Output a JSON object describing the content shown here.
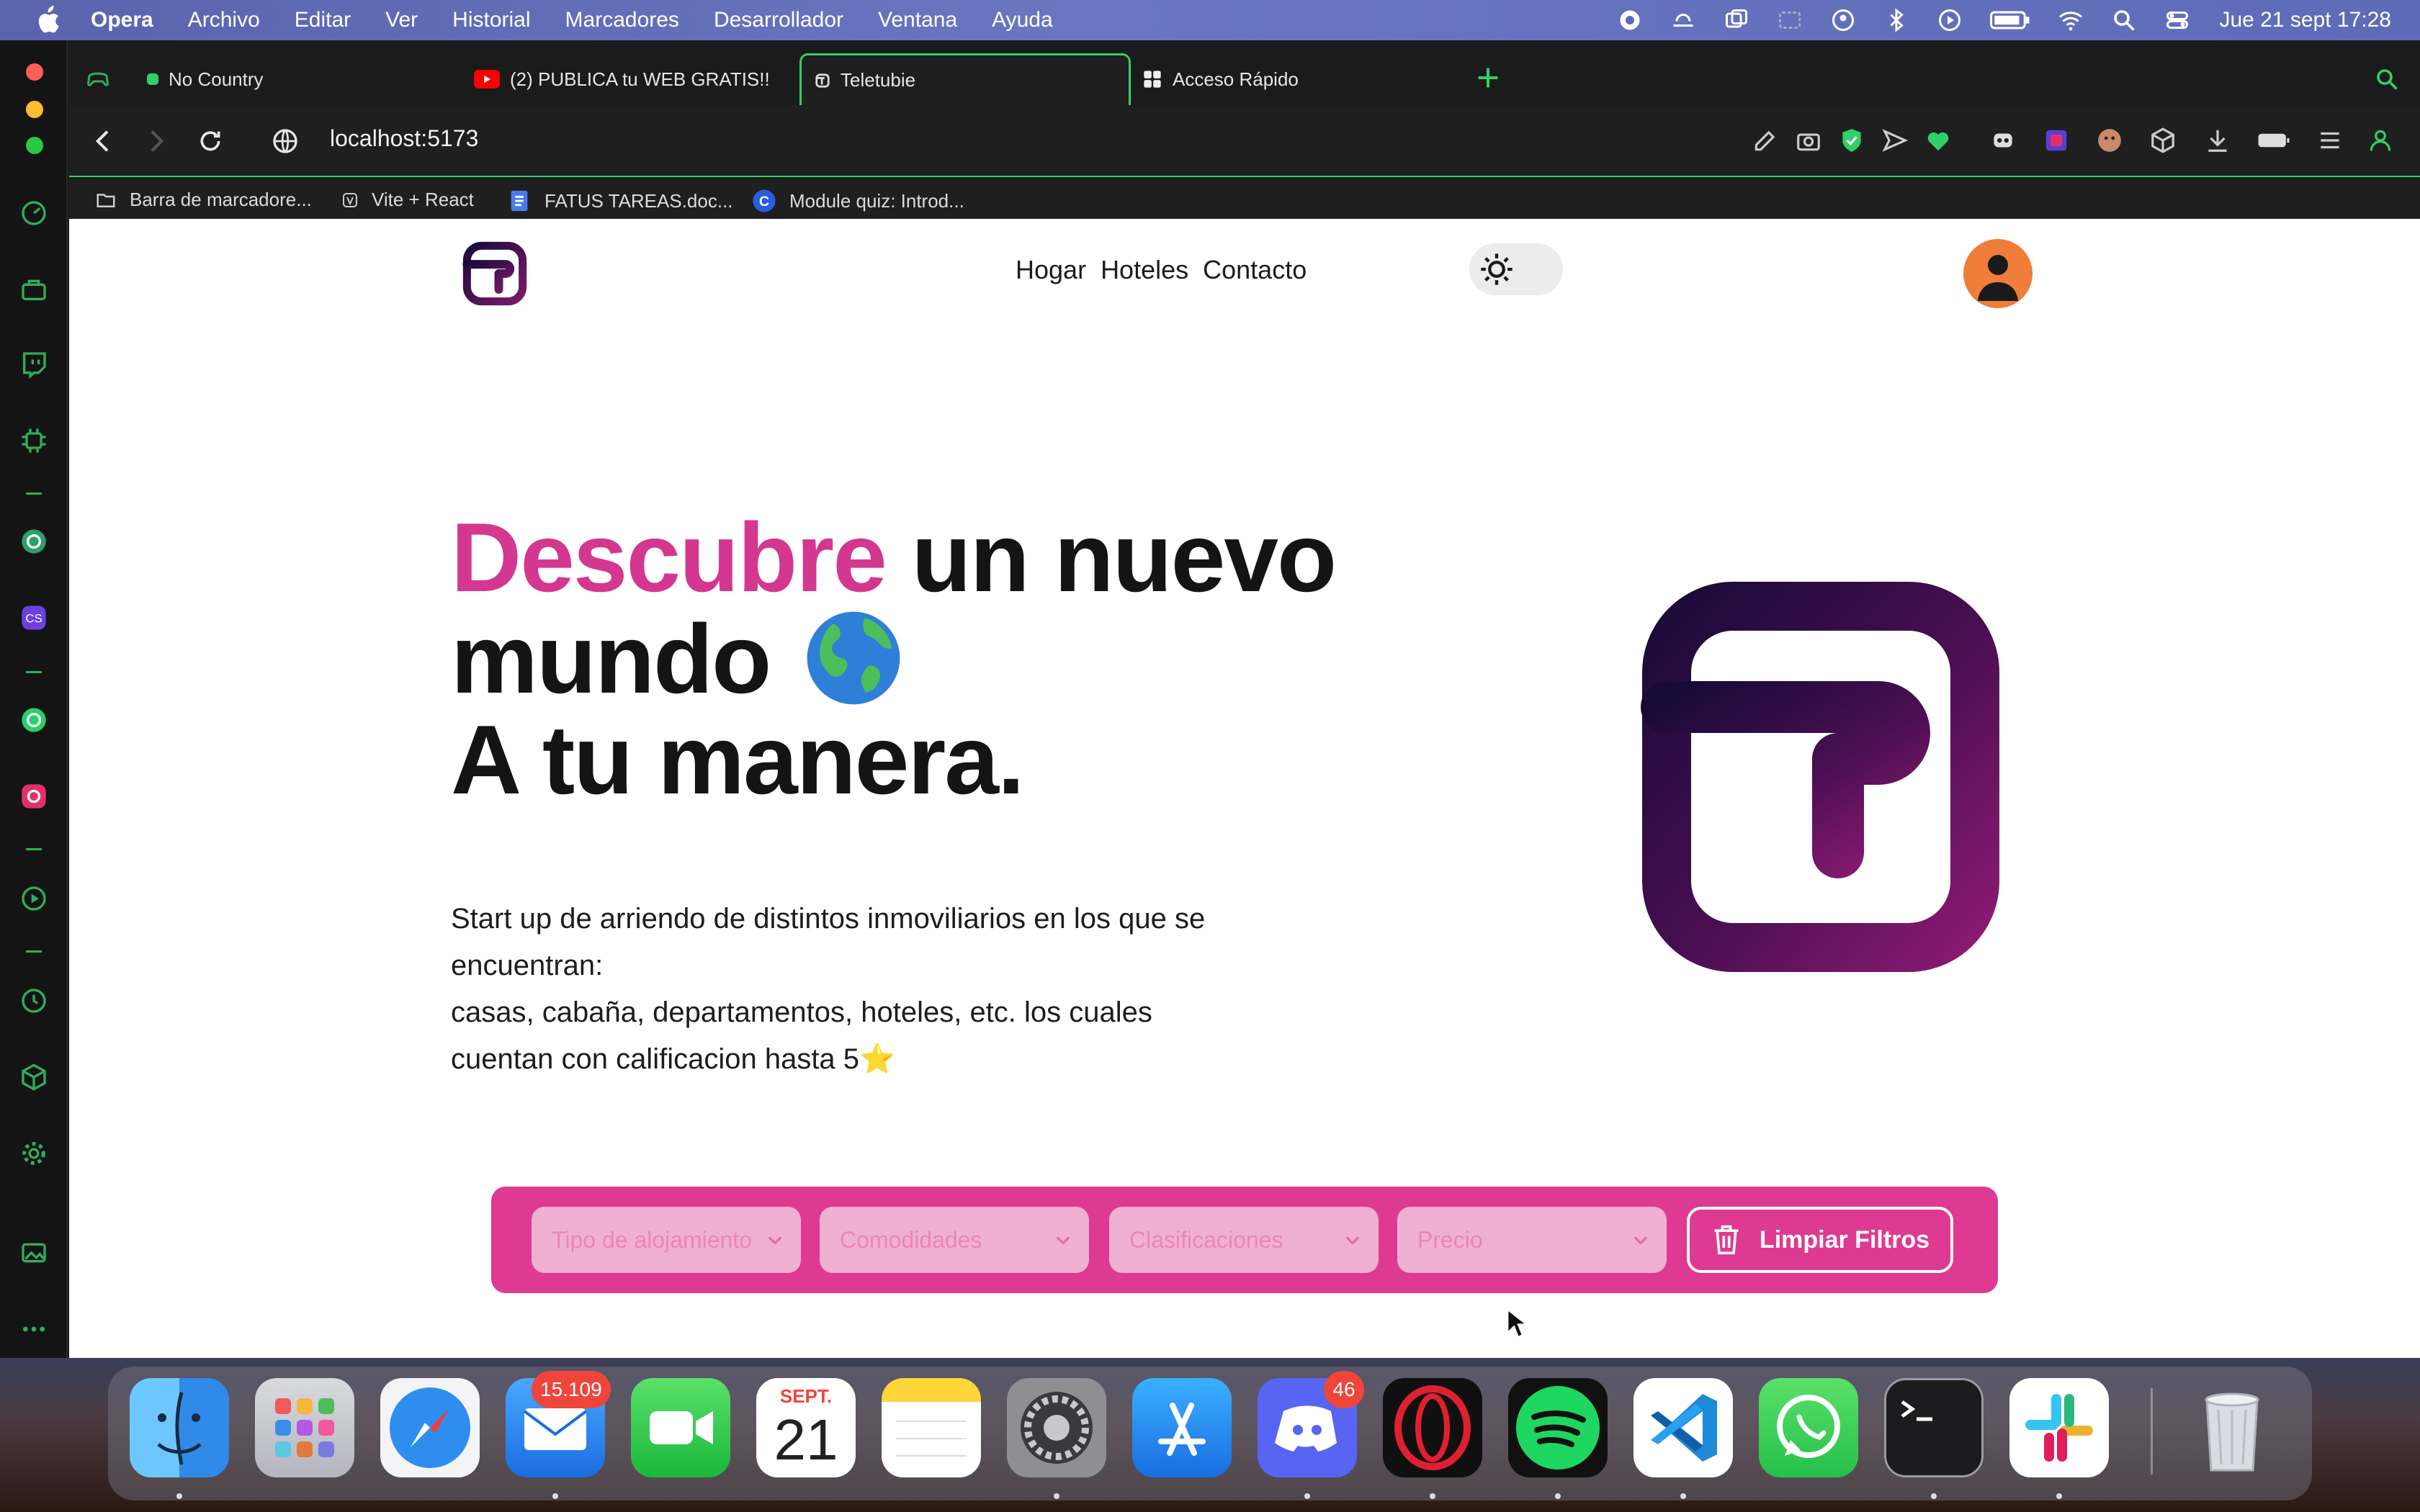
{
  "menubar": {
    "app_name": "Opera",
    "items": [
      "Archivo",
      "Editar",
      "Ver",
      "Historial",
      "Marcadores",
      "Desarrollador",
      "Ventana",
      "Ayuda"
    ],
    "clock": "Jue 21 sept  17:28"
  },
  "tabs": [
    {
      "label": "No Country",
      "icon": "green-dot-icon"
    },
    {
      "label": "(2) PUBLICA tu WEB GRATIS!!",
      "icon": "youtube-icon"
    },
    {
      "label": "Teletubie",
      "icon": "site-favicon",
      "active": true
    },
    {
      "label": "Acceso Rápido",
      "icon": "grid-icon"
    }
  ],
  "address": {
    "url": "localhost:5173"
  },
  "bookmarks": [
    {
      "label": "Barra de marcadore...",
      "icon": "folder-icon"
    },
    {
      "label": "Vite + React",
      "icon": "vite-icon"
    },
    {
      "label": "FATUS TAREAS.doc...",
      "icon": "docs-icon"
    },
    {
      "label": "Module quiz: Introd...",
      "icon": "coursera-icon"
    }
  ],
  "site": {
    "nav": {
      "home": "Hogar",
      "hotels": "Hoteles",
      "contact": "Contacto"
    },
    "hero": {
      "title_highlight": "Descubre",
      "title_rest": " un nuevo",
      "title_line2": "mundo",
      "title_line3": "A tu manera.",
      "desc_line1": "Start up de arriendo de distintos inmoviliarios en los que se encuentran:",
      "desc_line2": "casas, cabaña, departamentos, hoteles, etc. los cuales cuentan con calificacion hasta 5",
      "star": "⭐"
    },
    "filters": {
      "type_placeholder": "Tipo de alojamiento",
      "amenities_placeholder": "Comodidades",
      "ratings_placeholder": "Clasificaciones",
      "price_placeholder": "Precio",
      "clear_label": "Limpiar Filtros"
    }
  },
  "dock": {
    "mail_badge": "15.109",
    "calendar_month": "SEPT.",
    "calendar_day": "21",
    "discord_badge": "46"
  },
  "colors": {
    "accent": "#de3a92",
    "highlight_text": "#d4378f",
    "logo_dark": "#1a0a3a",
    "logo_mid": "#7a1a6a",
    "opera_green": "#2fd06a"
  }
}
